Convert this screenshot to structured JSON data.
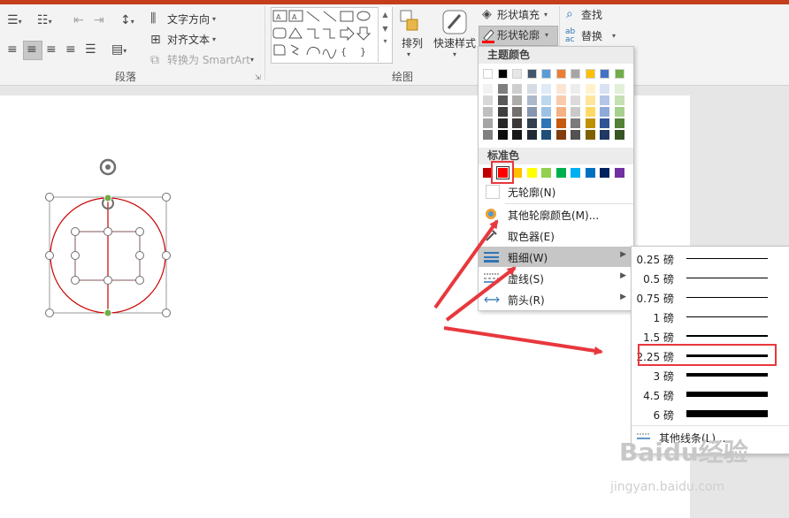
{
  "ribbon": {
    "paragraph_group": "段落",
    "drawing_group": "绘图",
    "text_direction": "文字方向",
    "align_text": "对齐文本",
    "convert_smartart": "转换为 SmartArt",
    "arrange": "排列",
    "quick_styles": "快速样式",
    "shape_fill": "形状填充",
    "shape_outline": "形状轮廓",
    "find": "查找",
    "replace": "替换"
  },
  "color_menu": {
    "theme_colors_header": "主题颜色",
    "standard_colors_header": "标准色",
    "no_outline": "无轮廓(N)",
    "more_colors": "其他轮廓颜色(M)...",
    "eyedropper": "取色器(E)",
    "weight": "粗细(W)",
    "dashes": "虚线(S)",
    "arrows": "箭头(R)",
    "theme_top_row": [
      "#ffffff",
      "#000000",
      "#e7e6e6",
      "#44546a",
      "#5b9bd5",
      "#ed7d31",
      "#a5a5a5",
      "#ffc000",
      "#4472c4",
      "#70ad47"
    ],
    "theme_shades": [
      [
        "#f2f2f2",
        "#7f7f7f",
        "#d0cece",
        "#d6dce4",
        "#deebf6",
        "#fbe5d5",
        "#ededed",
        "#fff2cc",
        "#d9e2f3",
        "#e2efd9"
      ],
      [
        "#d8d8d8",
        "#595959",
        "#aeabab",
        "#adb9ca",
        "#bdd7ee",
        "#f7cbac",
        "#dbdbdb",
        "#fee599",
        "#b4c6e7",
        "#c5e0b3"
      ],
      [
        "#bfbfbf",
        "#3f3f3f",
        "#757070",
        "#8496b0",
        "#9cc3e5",
        "#f4b183",
        "#c9c9c9",
        "#ffd965",
        "#8eaadb",
        "#a8d08d"
      ],
      [
        "#a5a5a5",
        "#262626",
        "#3a3838",
        "#323f4f",
        "#2e75b5",
        "#c55a11",
        "#7b7b7b",
        "#bf9000",
        "#2f5496",
        "#538135"
      ],
      [
        "#7f7f7f",
        "#0c0c0c",
        "#171616",
        "#222a35",
        "#1f4e79",
        "#833c0b",
        "#525252",
        "#7f6000",
        "#1f3864",
        "#375623"
      ]
    ],
    "standard_colors": [
      "#c00000",
      "#ff0000",
      "#ffc000",
      "#ffff00",
      "#92d050",
      "#00b050",
      "#00b0f0",
      "#0070c0",
      "#002060",
      "#7030a0"
    ],
    "selected_standard_color": "#ff0000"
  },
  "weight_menu": {
    "items": [
      "0.25 磅",
      "0.5 磅",
      "0.75 磅",
      "1 磅",
      "1.5 磅",
      "2.25 磅",
      "3 磅",
      "4.5 磅",
      "6 磅"
    ],
    "points": [
      0.25,
      0.5,
      0.75,
      1,
      1.5,
      2.25,
      3,
      4.5,
      6
    ],
    "selected": "2.25 磅",
    "more_lines": "其他线条(L)..."
  },
  "watermark": {
    "brand": "Baidu经验",
    "url": "jingyan.baidu.com"
  },
  "colors": {
    "accent_red": "#c43e1c",
    "annotation_red": "#e8383d",
    "shape_line": "#cc0000",
    "handle_green": "#70ad47"
  }
}
